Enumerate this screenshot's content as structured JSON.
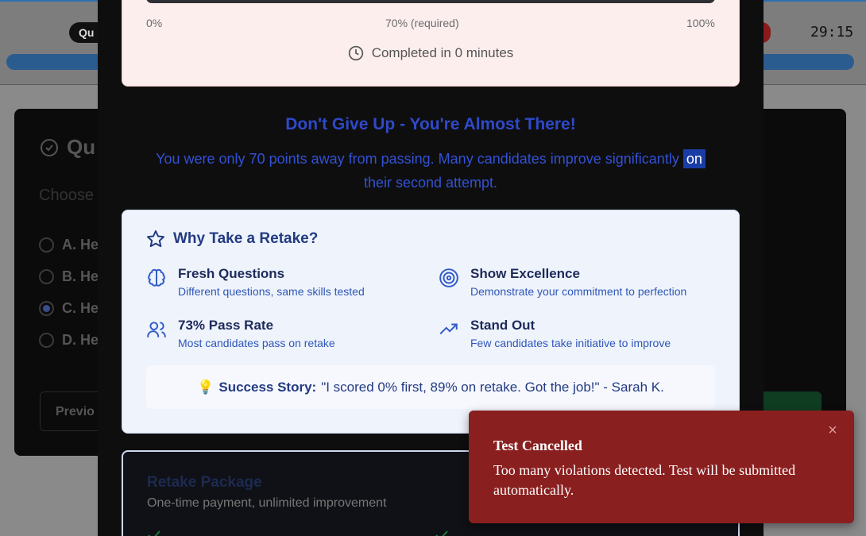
{
  "background": {
    "badge": "Qu",
    "timer": "29:15",
    "question_title": "Qu",
    "question_sub": "Choose",
    "options": [
      "A. He",
      "B. He",
      "C. He",
      "D. He"
    ],
    "selected_index": 2,
    "prev_label": "Previo"
  },
  "result": {
    "bar_left": "0%",
    "bar_mid": "70% (required)",
    "bar_right": "100%",
    "completed": "Completed in 0 minutes"
  },
  "encourage": {
    "title": "Don't Give Up - You're Almost There!",
    "text_before": "You were only 70 points away from passing. Many candidates improve significantly ",
    "highlight": "on",
    "text_after": " their second attempt."
  },
  "why": {
    "title": "Why Take a Retake?",
    "features": [
      {
        "icon": "brain-icon",
        "title": "Fresh Questions",
        "desc": "Different questions, same skills tested"
      },
      {
        "icon": "target-icon",
        "title": "Show Excellence",
        "desc": "Demonstrate your commitment to perfection"
      },
      {
        "icon": "users-icon",
        "title": "73% Pass Rate",
        "desc": "Most candidates pass on retake"
      },
      {
        "icon": "trending-up-icon",
        "title": "Stand Out",
        "desc": "Few candidates take initiative to improve"
      }
    ],
    "story_emoji": "💡",
    "story_label": "Success Story:",
    "story_text": "\"I scored 0% first, 89% on retake. Got the job!\" - Sarah K."
  },
  "package": {
    "title": "Retake Package",
    "subtitle": "One-time payment, unlimited improvement"
  },
  "toast": {
    "title": "Test Cancelled",
    "message": "Too many violations detected. Test will be submitted automatically.",
    "close": "×"
  },
  "colors": {
    "accent": "#2f49c9",
    "toast_bg": "#8a1f1f"
  }
}
